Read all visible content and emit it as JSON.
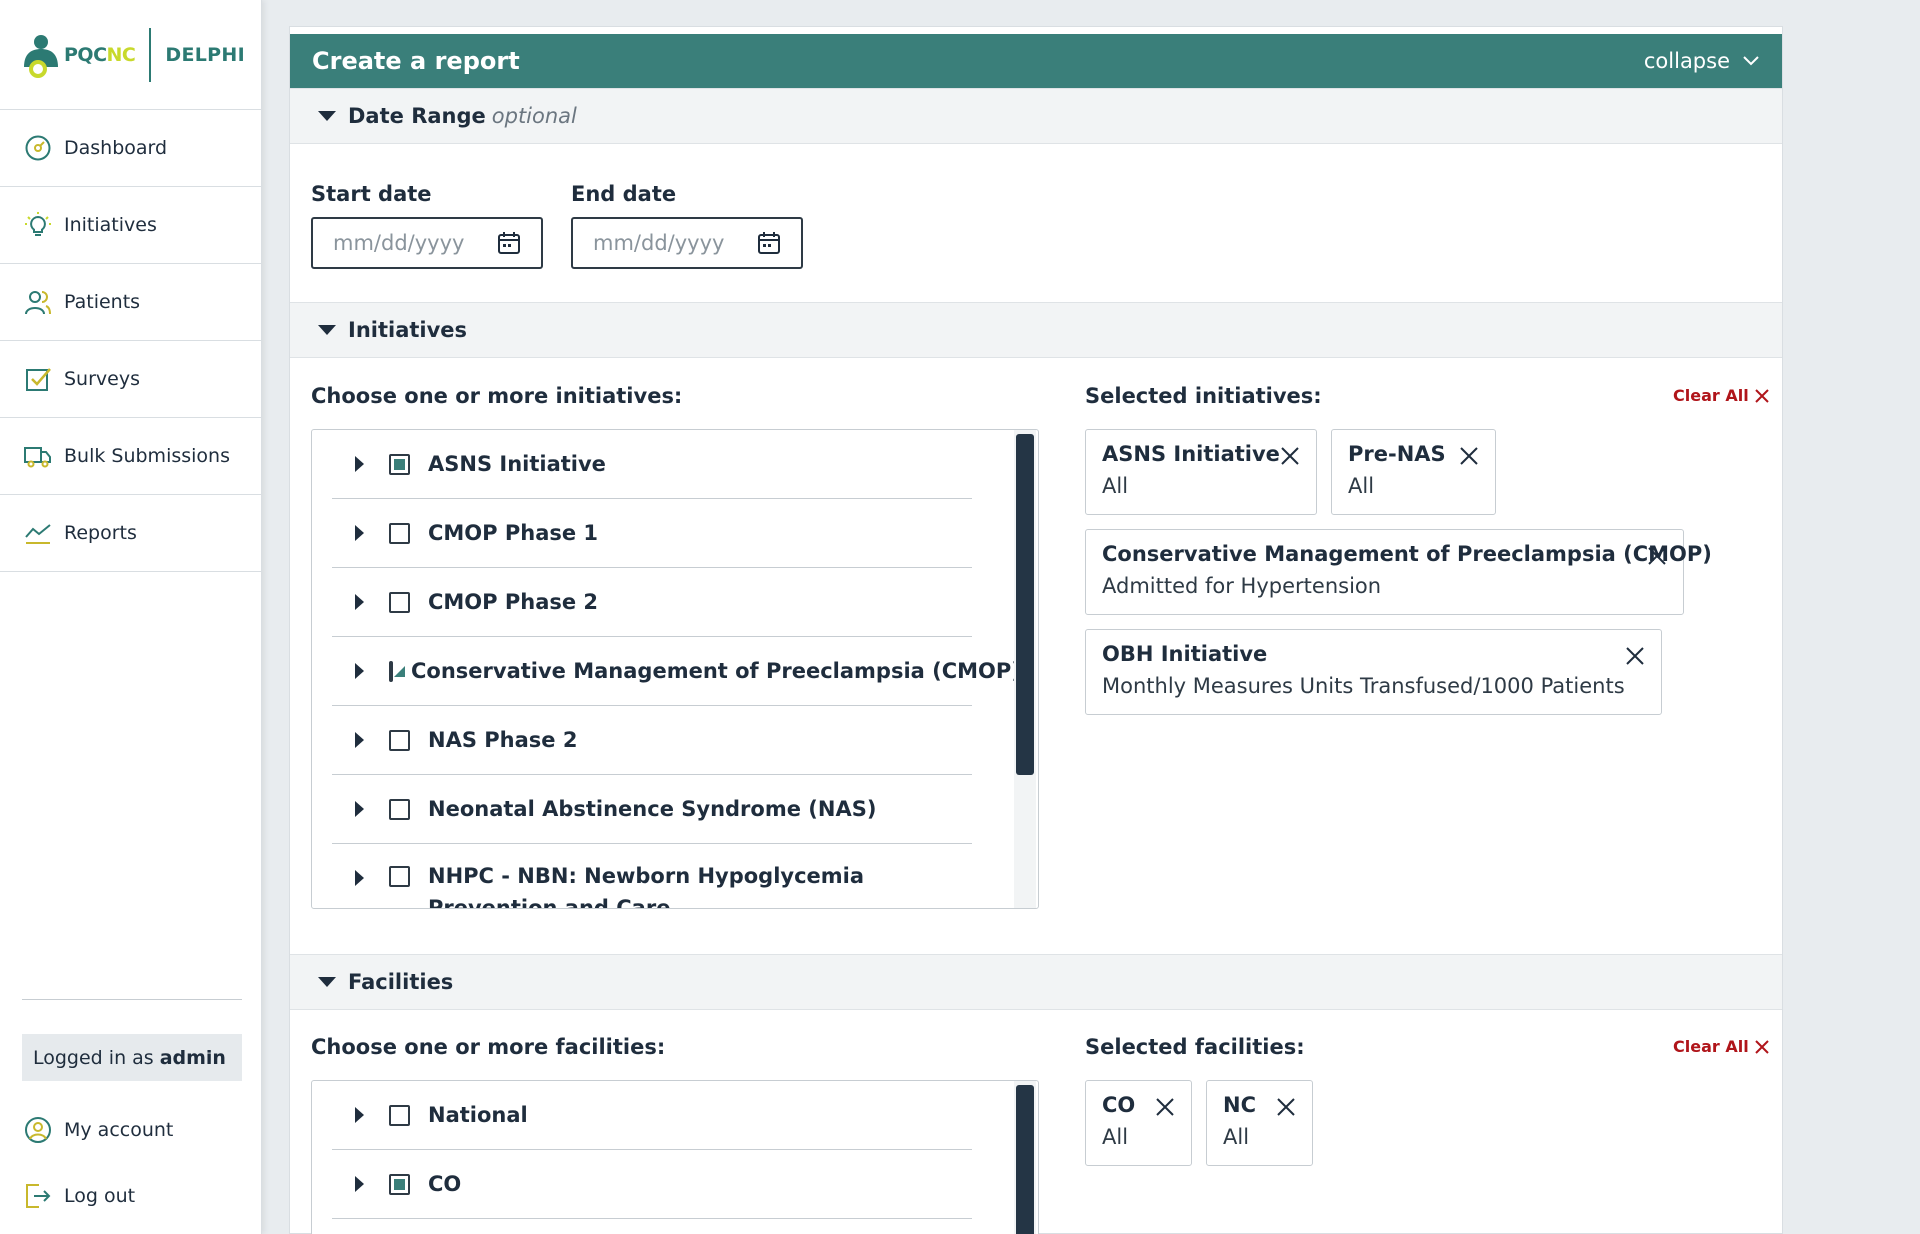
{
  "brand": {
    "left": "PQC",
    "left_accent": "NC",
    "right": "DELPHI"
  },
  "sidebar": {
    "items": [
      {
        "label": "Dashboard",
        "icon": "dashboard-gauge-icon"
      },
      {
        "label": "Initiatives",
        "icon": "lightbulb-icon"
      },
      {
        "label": "Patients",
        "icon": "people-icon"
      },
      {
        "label": "Surveys",
        "icon": "checkbox-icon"
      },
      {
        "label": "Bulk Submissions",
        "icon": "truck-icon"
      },
      {
        "label": "Reports",
        "icon": "line-chart-icon"
      }
    ],
    "logged_in_prefix": "Logged in as",
    "logged_in_user": "admin",
    "my_account": "My account",
    "log_out": "Log out"
  },
  "panel": {
    "title": "Create a report",
    "collapse_label": "collapse"
  },
  "date_range": {
    "title": "Date Range",
    "optional": "optional",
    "start_label": "Start date",
    "end_label": "End date",
    "start_placeholder": "mm/dd/yyyy",
    "end_placeholder": "mm/dd/yyyy"
  },
  "initiatives": {
    "title": "Initiatives",
    "choose_label": "Choose one or more initiatives:",
    "selected_label": "Selected initiatives:",
    "clear_all": "Clear All",
    "list": [
      {
        "label": "ASNS Initiative",
        "state": "full"
      },
      {
        "label": "CMOP Phase 1",
        "state": "none"
      },
      {
        "label": "CMOP Phase 2",
        "state": "none"
      },
      {
        "label": "Conservative Management of Preeclampsia (CMOP)",
        "state": "partial"
      },
      {
        "label": "NAS Phase 2",
        "state": "none"
      },
      {
        "label": "Neonatal Abstinence Syndrome (NAS)",
        "state": "none"
      },
      {
        "label": "NHPC - NBN: Newborn Hypoglycemia Prevention and Care",
        "state": "none"
      }
    ],
    "selected": [
      {
        "title": "ASNS Initiative",
        "sub": "All"
      },
      {
        "title": "Pre-NAS",
        "sub": "All"
      },
      {
        "title": "Conservative Management of Preeclampsia (CMOP)",
        "sub": "Admitted for Hypertension"
      },
      {
        "title": "OBH Initiative",
        "sub": "Monthly Measures Units Transfused/1000 Patients"
      }
    ]
  },
  "facilities": {
    "title": "Facilities",
    "choose_label": "Choose one or more facilities:",
    "selected_label": "Selected facilities:",
    "clear_all": "Clear All",
    "list": [
      {
        "label": "National",
        "state": "none"
      },
      {
        "label": "CO",
        "state": "full"
      }
    ],
    "selected": [
      {
        "title": "CO",
        "sub": "All"
      },
      {
        "title": "NC",
        "sub": "All"
      }
    ]
  },
  "colors": {
    "header_teal": "#3a7f7a",
    "accent_lime": "#c8d92c",
    "clear_red": "#b0151a"
  }
}
